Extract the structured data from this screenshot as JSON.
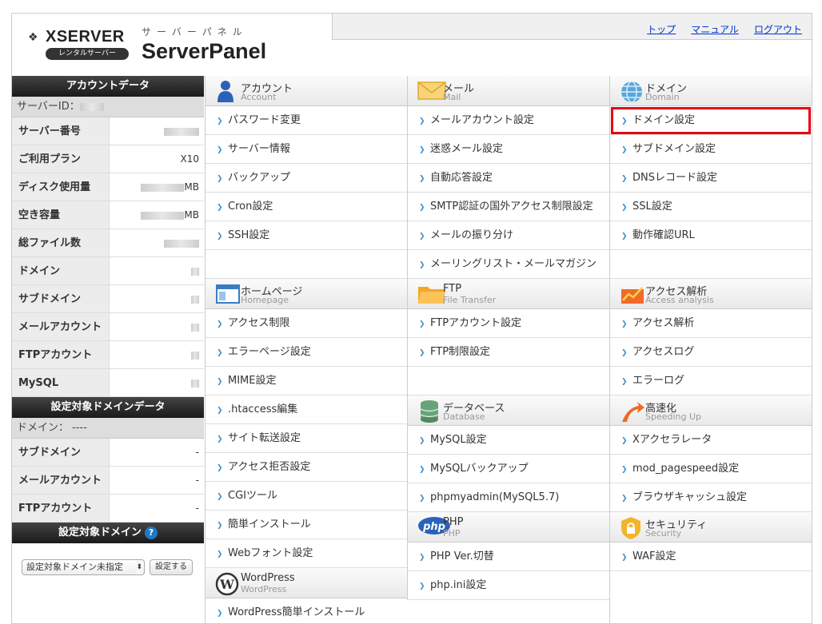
{
  "header": {
    "brand": "XSERVER",
    "brand_badge": "レンタルサーバー",
    "panel_sub": "サーバーパネル",
    "panel_title": "ServerPanel",
    "nav": [
      "トップ",
      "マニュアル",
      "ログアウト"
    ]
  },
  "sidebar": {
    "account_title": "アカウントデータ",
    "server_id_label": "サーバーID：",
    "account_rows": [
      {
        "label": "サーバー番号",
        "value": ""
      },
      {
        "label": "ご利用プラン",
        "value": "X10"
      },
      {
        "label": "ディスク使用量",
        "value": "MB"
      },
      {
        "label": "空き容量",
        "value": "MB"
      },
      {
        "label": "総ファイル数",
        "value": ""
      },
      {
        "label": "ドメイン",
        "value": ""
      },
      {
        "label": "サブドメイン",
        "value": ""
      },
      {
        "label": "メールアカウント",
        "value": ""
      },
      {
        "label": "FTPアカウント",
        "value": ""
      },
      {
        "label": "MySQL",
        "value": ""
      }
    ],
    "domain_data_title": "設定対象ドメインデータ",
    "domain_label": "ドメイン：",
    "domain_value": "----",
    "domain_rows": [
      {
        "label": "サブドメイン",
        "value": "-"
      },
      {
        "label": "メールアカウント",
        "value": "-"
      },
      {
        "label": "FTPアカウント",
        "value": "-"
      }
    ],
    "target_title": "設定対象ドメイン",
    "help_glyph": "?",
    "select_value": "設定対象ドメイン未指定",
    "select_arrow": "⬍",
    "set_button": "設定する"
  },
  "columns": [
    {
      "sections": [
        {
          "jp": "アカウント",
          "en": "Account",
          "icon": "account-icon",
          "items": [
            "パスワード変更",
            "サーバー情報",
            "バックアップ",
            "Cron設定",
            "SSH設定"
          ],
          "pad": 1
        },
        {
          "jp": "ホームページ",
          "en": "Homepage",
          "icon": "homepage-icon",
          "items": [
            "アクセス制限",
            "エラーページ設定",
            "MIME設定",
            ".htaccess編集",
            "サイト転送設定",
            "アクセス拒否設定",
            "CGIツール",
            "簡単インストール",
            "Webフォント設定"
          ],
          "pad": 0
        },
        {
          "jp": "WordPress",
          "en": "WordPress",
          "icon": "wordpress-icon",
          "items": [
            "WordPress簡単インストール"
          ],
          "pad": 0
        }
      ]
    },
    {
      "sections": [
        {
          "jp": "メール",
          "en": "Mail",
          "icon": "mail-icon",
          "items": [
            "メールアカウント設定",
            "迷惑メール設定",
            "自動応答設定",
            "SMTP認証の国外アクセス制限設定",
            "メールの振り分け",
            "メーリングリスト・メールマガジン"
          ],
          "pad": 0
        },
        {
          "jp": "FTP",
          "en": "File Transfer",
          "icon": "ftp-folder-icon",
          "items": [
            "FTPアカウント設定",
            "FTP制限設定"
          ],
          "pad": 1
        },
        {
          "jp": "データベース",
          "en": "Database",
          "icon": "database-icon",
          "items": [
            "MySQL設定",
            "MySQLバックアップ",
            "phpmyadmin(MySQL5.7)"
          ],
          "pad": 0
        },
        {
          "jp": "PHP",
          "en": "PHP",
          "icon": "php-icon",
          "items": [
            "PHP Ver.切替",
            "php.ini設定"
          ],
          "pad": 0
        }
      ]
    },
    {
      "sections": [
        {
          "jp": "ドメイン",
          "en": "Domain",
          "icon": "domain-globe-icon",
          "items": [
            "ドメイン設定",
            "サブドメイン設定",
            "DNSレコード設定",
            "SSL設定",
            "動作確認URL"
          ],
          "pad": 1,
          "highlight": 0
        },
        {
          "jp": "アクセス解析",
          "en": "Access analysis",
          "icon": "access-analysis-icon",
          "items": [
            "アクセス解析",
            "アクセスログ",
            "エラーログ"
          ],
          "pad": 0
        },
        {
          "jp": "高速化",
          "en": "Speeding Up",
          "icon": "speed-up-icon",
          "items": [
            "Xアクセラレータ",
            "mod_pagespeed設定",
            "ブラウザキャッシュ設定"
          ],
          "pad": 0
        },
        {
          "jp": "セキュリティ",
          "en": "Security",
          "icon": "security-lock-icon",
          "items": [
            "WAF設定"
          ],
          "pad": 2
        }
      ]
    }
  ],
  "colors": {
    "highlight": "#e60012",
    "link": "#0033cc",
    "bullet": "#3a8fd0"
  }
}
